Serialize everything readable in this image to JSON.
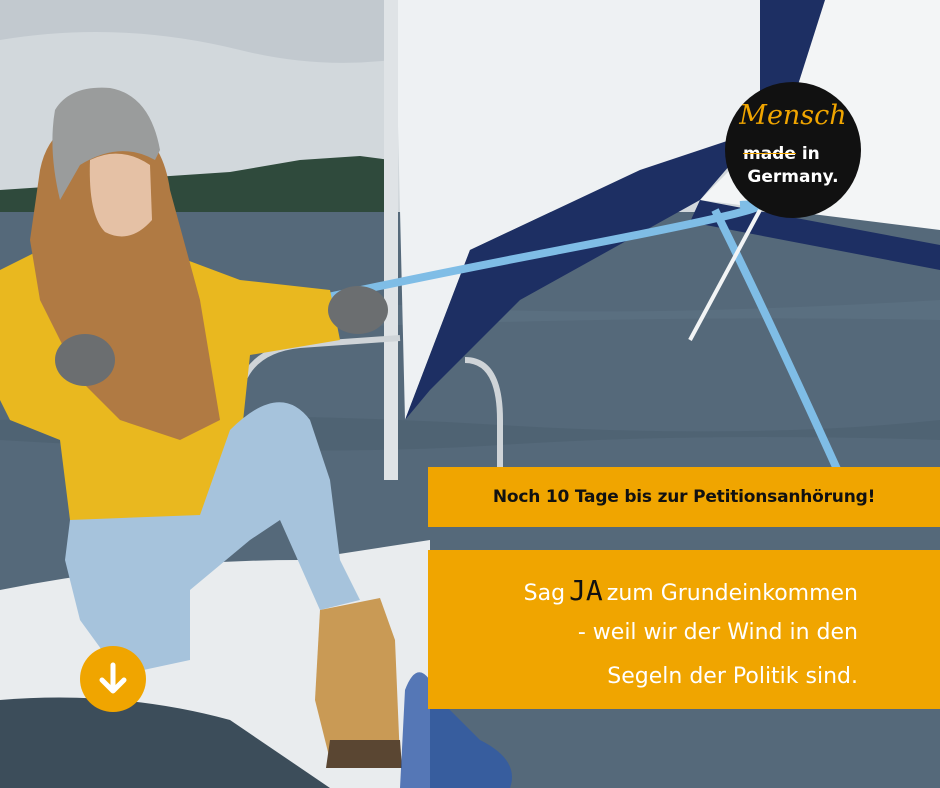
{
  "banner_top": {
    "text": "Noch 10 Tage bis zur Petitionsanhörung!"
  },
  "banner_main": {
    "line1_prefix": "Sag",
    "line1_highlight": "JA",
    "line1_suffix": "zum Grundeinkommen",
    "line2": "-  weil wir der Wind in den",
    "line3": "Segeln der Politik sind."
  },
  "logo": {
    "word1": "Mensch",
    "word2_struck": "made",
    "word2_rest": "in",
    "word3": "Germany."
  },
  "icons": {
    "scroll_down": "arrow-down-icon"
  },
  "colors": {
    "accent": "#f0a500",
    "logo_bg": "#111111",
    "text_light": "#ffffff"
  }
}
